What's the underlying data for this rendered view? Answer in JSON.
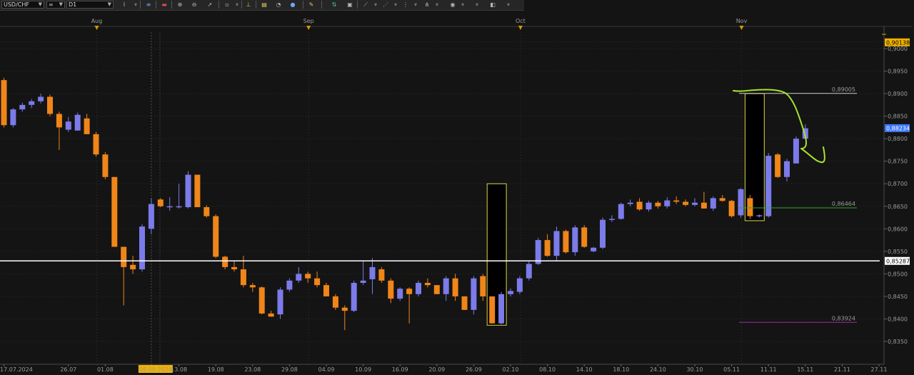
{
  "toolbar": {
    "symbol": "USD/CHF",
    "link": "∞",
    "period": "D1"
  },
  "chart_data": {
    "type": "candlestick",
    "symbol": "USD/CHF",
    "timeframe": "D1",
    "colors": {
      "bull": "#7b7bea",
      "bear": "#f08519",
      "background": "#141414",
      "hline": "#ffffff",
      "pen": "#a8e22b"
    },
    "ylim": [
      0.833,
      0.9015
    ],
    "price_ticks": [
      "0,9000",
      "0,8950",
      "0,8900",
      "0,8850",
      "0,8800",
      "0,8750",
      "0,8700",
      "0,8650",
      "0,8600",
      "0,8550",
      "0,8500",
      "0,8450",
      "0,8400",
      "0,8350"
    ],
    "price_tick_values": [
      0.9,
      0.895,
      0.89,
      0.885,
      0.88,
      0.875,
      0.87,
      0.865,
      0.86,
      0.855,
      0.85,
      0.845,
      0.84,
      0.835
    ],
    "month_markers": [
      {
        "label": "Aug",
        "i": 10
      },
      {
        "label": "Sep",
        "i": 33
      },
      {
        "label": "Oct",
        "i": 56
      },
      {
        "label": "Nov",
        "i": 80
      }
    ],
    "date_labels": [
      {
        "label": "17.07.2024",
        "i": 0
      },
      {
        "label": "26.07",
        "i": 7
      },
      {
        "label": "01.08",
        "i": 11
      },
      {
        "label": "08.08.2024",
        "i": 16,
        "highlight": true
      },
      {
        "label": "13.08",
        "i": 19
      },
      {
        "label": "19.08",
        "i": 23
      },
      {
        "label": "23.08",
        "i": 27
      },
      {
        "label": "29.08",
        "i": 31
      },
      {
        "label": "04.09",
        "i": 35
      },
      {
        "label": "10.09",
        "i": 39
      },
      {
        "label": "16.09",
        "i": 43
      },
      {
        "label": "20.09",
        "i": 47
      },
      {
        "label": "26.09",
        "i": 51
      },
      {
        "label": "02.10",
        "i": 55
      },
      {
        "label": "08.10",
        "i": 59
      },
      {
        "label": "14.10",
        "i": 63
      },
      {
        "label": "18.10",
        "i": 67
      },
      {
        "label": "24.10",
        "i": 71
      },
      {
        "label": "30.10",
        "i": 75
      },
      {
        "label": "05.11",
        "i": 79
      },
      {
        "label": "11.11",
        "i": 83
      },
      {
        "label": "15.11",
        "i": 87
      },
      {
        "label": "21.11",
        "i": 91
      },
      {
        "label": "27.11",
        "i": 95
      }
    ],
    "candles": [
      [
        0.893,
        0.8935,
        0.8825,
        0.883
      ],
      [
        0.883,
        0.8868,
        0.8825,
        0.8865
      ],
      [
        0.8865,
        0.888,
        0.886,
        0.8875
      ],
      [
        0.8875,
        0.8888,
        0.8868,
        0.8883
      ],
      [
        0.8883,
        0.89,
        0.8878,
        0.8893
      ],
      [
        0.8893,
        0.8898,
        0.885,
        0.8855
      ],
      [
        0.8855,
        0.886,
        0.8775,
        0.8825
      ],
      [
        0.882,
        0.8848,
        0.8815,
        0.8838
      ],
      [
        0.8818,
        0.8858,
        0.8818,
        0.8853
      ],
      [
        0.8845,
        0.8855,
        0.881,
        0.881
      ],
      [
        0.881,
        0.8815,
        0.876,
        0.8765
      ],
      [
        0.8765,
        0.877,
        0.871,
        0.8715
      ],
      [
        0.8715,
        0.8715,
        0.856,
        0.856
      ],
      [
        0.856,
        0.856,
        0.843,
        0.8515
      ],
      [
        0.852,
        0.854,
        0.85,
        0.851
      ],
      [
        0.851,
        0.861,
        0.8505,
        0.8605
      ],
      [
        0.86,
        0.8668,
        0.8588,
        0.8655
      ],
      [
        0.8665,
        0.8668,
        0.8648,
        0.865
      ],
      [
        0.865,
        0.867,
        0.864,
        0.865
      ],
      [
        0.865,
        0.87,
        0.8645,
        0.865
      ],
      [
        0.8648,
        0.8728,
        0.8645,
        0.872
      ],
      [
        0.872,
        0.872,
        0.865,
        0.8648
      ],
      [
        0.8648,
        0.8652,
        0.8625,
        0.8628
      ],
      [
        0.8628,
        0.8632,
        0.8535,
        0.8538
      ],
      [
        0.8538,
        0.854,
        0.851,
        0.8515
      ],
      [
        0.8515,
        0.853,
        0.8505,
        0.851
      ],
      [
        0.851,
        0.854,
        0.847,
        0.8475
      ],
      [
        0.8475,
        0.848,
        0.846,
        0.847
      ],
      [
        0.847,
        0.8472,
        0.841,
        0.8412
      ],
      [
        0.8412,
        0.8418,
        0.8405,
        0.8405
      ],
      [
        0.841,
        0.847,
        0.84,
        0.8465
      ],
      [
        0.8465,
        0.849,
        0.846,
        0.8485
      ],
      [
        0.8485,
        0.8515,
        0.848,
        0.85
      ],
      [
        0.85,
        0.8505,
        0.848,
        0.849
      ],
      [
        0.849,
        0.8505,
        0.847,
        0.8475
      ],
      [
        0.8475,
        0.848,
        0.845,
        0.845
      ],
      [
        0.845,
        0.8455,
        0.842,
        0.8425
      ],
      [
        0.8425,
        0.843,
        0.8375,
        0.8418
      ],
      [
        0.8418,
        0.8485,
        0.8415,
        0.848
      ],
      [
        0.848,
        0.853,
        0.8475,
        0.8485
      ],
      [
        0.8488,
        0.8535,
        0.8455,
        0.8515
      ],
      [
        0.851,
        0.8515,
        0.848,
        0.8485
      ],
      [
        0.8485,
        0.849,
        0.8435,
        0.8445
      ],
      [
        0.8445,
        0.847,
        0.844,
        0.8467
      ],
      [
        0.8467,
        0.847,
        0.839,
        0.8455
      ],
      [
        0.8455,
        0.8485,
        0.845,
        0.848
      ],
      [
        0.848,
        0.849,
        0.847,
        0.8475
      ],
      [
        0.8475,
        0.8475,
        0.8455,
        0.8455
      ],
      [
        0.8455,
        0.8495,
        0.844,
        0.849
      ],
      [
        0.849,
        0.85,
        0.844,
        0.845
      ],
      [
        0.845,
        0.845,
        0.842,
        0.842
      ],
      [
        0.842,
        0.8495,
        0.841,
        0.849
      ],
      [
        0.8495,
        0.85,
        0.844,
        0.845
      ],
      [
        0.845,
        0.845,
        0.839,
        0.839
      ],
      [
        0.839,
        0.846,
        0.8388,
        0.8455
      ],
      [
        0.8455,
        0.8468,
        0.845,
        0.8462
      ],
      [
        0.846,
        0.8495,
        0.8455,
        0.849
      ],
      [
        0.849,
        0.8528,
        0.8485,
        0.8522
      ],
      [
        0.8522,
        0.858,
        0.852,
        0.8575
      ],
      [
        0.8575,
        0.8588,
        0.8538,
        0.854
      ],
      [
        0.854,
        0.8605,
        0.853,
        0.8595
      ],
      [
        0.8595,
        0.8598,
        0.8545,
        0.8548
      ],
      [
        0.8548,
        0.8608,
        0.854,
        0.8603
      ],
      [
        0.8603,
        0.8608,
        0.8558,
        0.856
      ],
      [
        0.855,
        0.856,
        0.8548,
        0.8558
      ],
      [
        0.8558,
        0.8625,
        0.8555,
        0.862
      ],
      [
        0.862,
        0.863,
        0.8615,
        0.8622
      ],
      [
        0.8622,
        0.8658,
        0.862,
        0.8655
      ],
      [
        0.8655,
        0.8665,
        0.865,
        0.8658
      ],
      [
        0.866,
        0.8668,
        0.864,
        0.8643
      ],
      [
        0.8643,
        0.8662,
        0.8638,
        0.8658
      ],
      [
        0.8658,
        0.8662,
        0.8645,
        0.865
      ],
      [
        0.865,
        0.867,
        0.8645,
        0.8663
      ],
      [
        0.8663,
        0.8672,
        0.8655,
        0.866
      ],
      [
        0.866,
        0.8665,
        0.865,
        0.8653
      ],
      [
        0.8653,
        0.8668,
        0.865,
        0.8658
      ],
      [
        0.8658,
        0.8682,
        0.8645,
        0.8645
      ],
      [
        0.8645,
        0.8672,
        0.864,
        0.8668
      ],
      [
        0.8668,
        0.8675,
        0.866,
        0.8662
      ],
      [
        0.8662,
        0.8664,
        0.8625,
        0.8628
      ],
      [
        0.863,
        0.869,
        0.8625,
        0.8688
      ],
      [
        0.8668,
        0.8675,
        0.8622,
        0.8628
      ],
      [
        0.8628,
        0.8632,
        0.8625,
        0.863
      ],
      [
        0.8628,
        0.8768,
        0.8625,
        0.8762
      ],
      [
        0.8765,
        0.8768,
        0.8713,
        0.8715
      ],
      [
        0.8715,
        0.8755,
        0.8705,
        0.875
      ],
      [
        0.8745,
        0.8805,
        0.8745,
        0.88
      ],
      [
        0.88,
        0.8832,
        0.88,
        0.8823
      ]
    ],
    "horizontal_lines": [
      {
        "name": "support-line",
        "value": 0.85287,
        "label": "0,85287"
      },
      {
        "name": "level-upper",
        "value": 0.89005,
        "label": "0,89005"
      },
      {
        "name": "level-middle",
        "value": 0.86464,
        "label": "0,86464"
      },
      {
        "name": "level-lower",
        "value": 0.83924,
        "label": "0,83924"
      }
    ],
    "price_tags": [
      {
        "name": "price-tag-top",
        "value": 0.90138,
        "label": "0,90138",
        "bg": "#f0b200",
        "fg": "#000000"
      },
      {
        "name": "price-tag-current",
        "value": 0.88234,
        "label": "0,88234",
        "bg": "#3f78ff",
        "fg": "#ffffff"
      },
      {
        "name": "price-tag-line",
        "value": 0.85287,
        "label": "0,85287",
        "bg": "#ffffff",
        "fg": "#000000"
      }
    ],
    "boxes": [
      {
        "name": "highlight-box-sep",
        "from_i": 53,
        "to_i": 54,
        "top": 0.87,
        "bottom": 0.8386
      },
      {
        "name": "highlight-box-nov",
        "from_i": 81,
        "to_i": 82,
        "top": 0.89,
        "bottom": 0.8618
      }
    ]
  }
}
